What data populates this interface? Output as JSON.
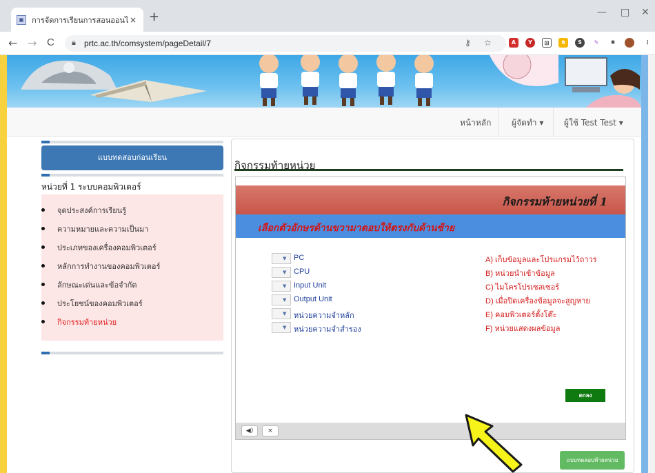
{
  "browser": {
    "tab_title": "การจัดการเรียนการสอนออนไลน์",
    "tab_close": "×",
    "new_tab": "+",
    "url": "prtc.ac.th/comsystem/pageDetail/7",
    "back": "←",
    "forward": "→",
    "reload": "C",
    "minimize": "—",
    "maximize": "□",
    "close": "✕"
  },
  "navbar": {
    "home": "หน้าหลัก",
    "author": "ผู้จัดทำ ▾",
    "user": "ผู้ใช้ Test Test ▾"
  },
  "sidebar": {
    "pretest_button": "แบบทดสอบก่อนเรียน",
    "unit_title": "หน่วยที่ 1 ระบบคอมพิวเตอร์",
    "items": [
      {
        "label": "จุดประสงค์การเรียนรู้"
      },
      {
        "label": "ความหมายและความเป็นมา"
      },
      {
        "label": "ประเภทของเครื่องคอมพิวเตอร์"
      },
      {
        "label": "หลักการทำงานของคอมพิวเตอร์"
      },
      {
        "label": "ลักษณะเด่นและข้อจำกัด"
      },
      {
        "label": "ประโยชน์ของคอมพิวเตอร์"
      },
      {
        "label": "กิจกรรมท้ายหน่วย"
      }
    ]
  },
  "main": {
    "title": "กิจกรรมท้ายหน่วย",
    "activity": {
      "header": "กิจกรรมท้ายหน่วยที่ 1",
      "instruction": "เลือกตัวอักษรด้านขวามาตอบให้ตรงกับด้านซ้าย",
      "left_items": [
        "PC",
        "CPU",
        "Input Unit",
        "Output Unit",
        "หน่วยความจำหลัก",
        "หน่วยความจำสำรอง"
      ],
      "right_items": [
        "A) เก็บข้อมูลและโปรแกรมไว้ถาวร",
        "B) หน่วยนำเข้าข้อมูล",
        "C) ไมโครโปรเซสเซอร์",
        "D) เมื่อปิดเครื่องข้อมูลจะสูญหาย",
        "E) คอมพิวเตอร์ตั้งโต๊ะ",
        "F) หน่วยแสดงผลข้อมูล"
      ],
      "ok_button": "ตกลง",
      "sound_button": "◀)",
      "close_button": "×"
    },
    "posttest_button": "แบบทดสอบท้ายหน่วย"
  }
}
